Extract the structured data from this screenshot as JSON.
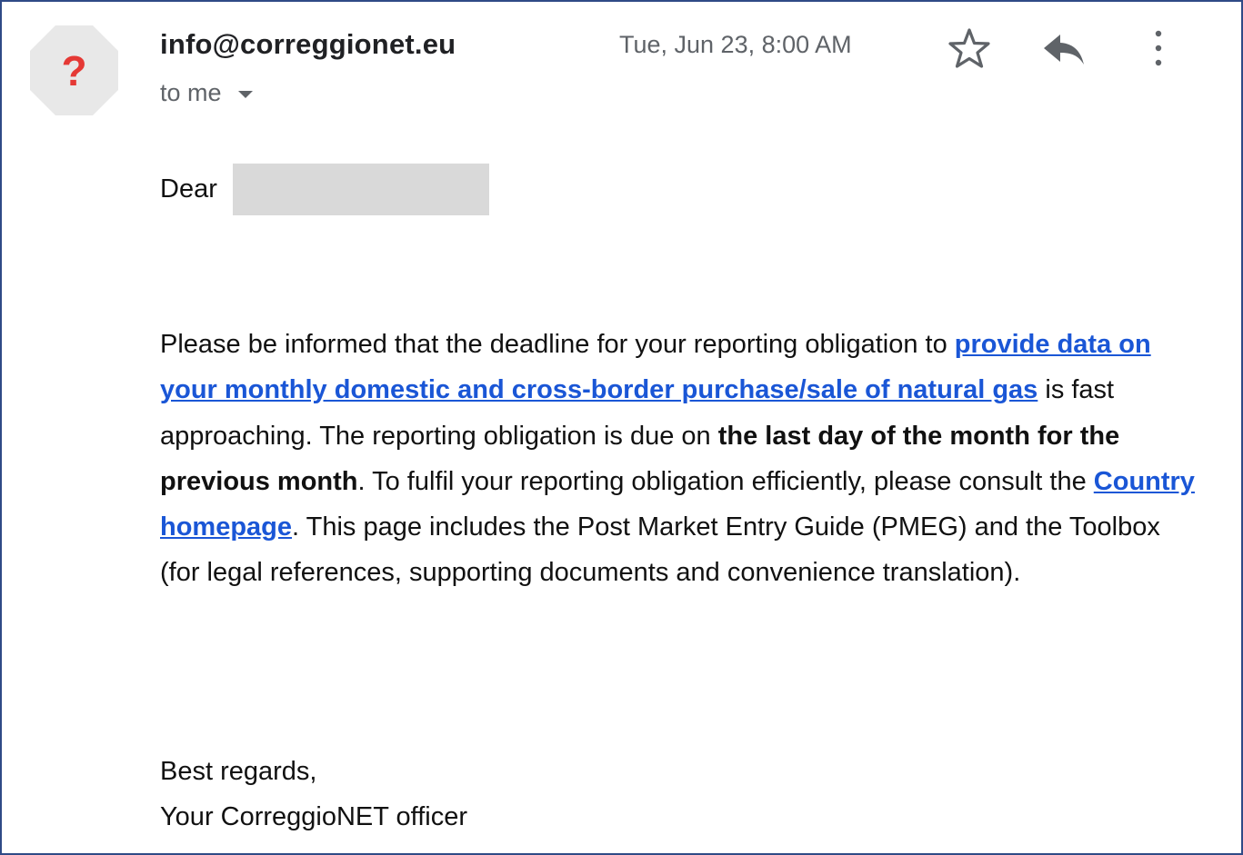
{
  "email": {
    "sender": "info@correggionet.eu",
    "recipient_label": "to me",
    "date": "Tue, Jun 23, 8:00 AM",
    "avatar_glyph": "?",
    "avatar_color": "#e53935",
    "icons": {
      "star": "star-outline-icon",
      "reply": "reply-icon",
      "more": "more-vert-icon",
      "recipient_dropdown": "caret-down-icon"
    }
  },
  "body": {
    "greeting": "Dear",
    "p1_start": "Please be informed that the deadline for your reporting obligation to ",
    "link1": "provide data on your monthly domestic and cross-border purchase/sale of natural gas",
    "p1_mid": " is fast approaching. The reporting obligation is due on ",
    "bold1": "the last day of the month for the previous month",
    "p1_mid2": ". To fulfil your reporting obligation efficiently, please consult the ",
    "link2": "Country homepage",
    "p1_end": ". This page includes the Post Market Entry Guide (PMEG) and the Toolbox (for legal references, supporting documents and convenience translation).",
    "closing": "Best regards,",
    "signature": "Your CorreggioNET officer",
    "link_color": "#1a56d6"
  }
}
